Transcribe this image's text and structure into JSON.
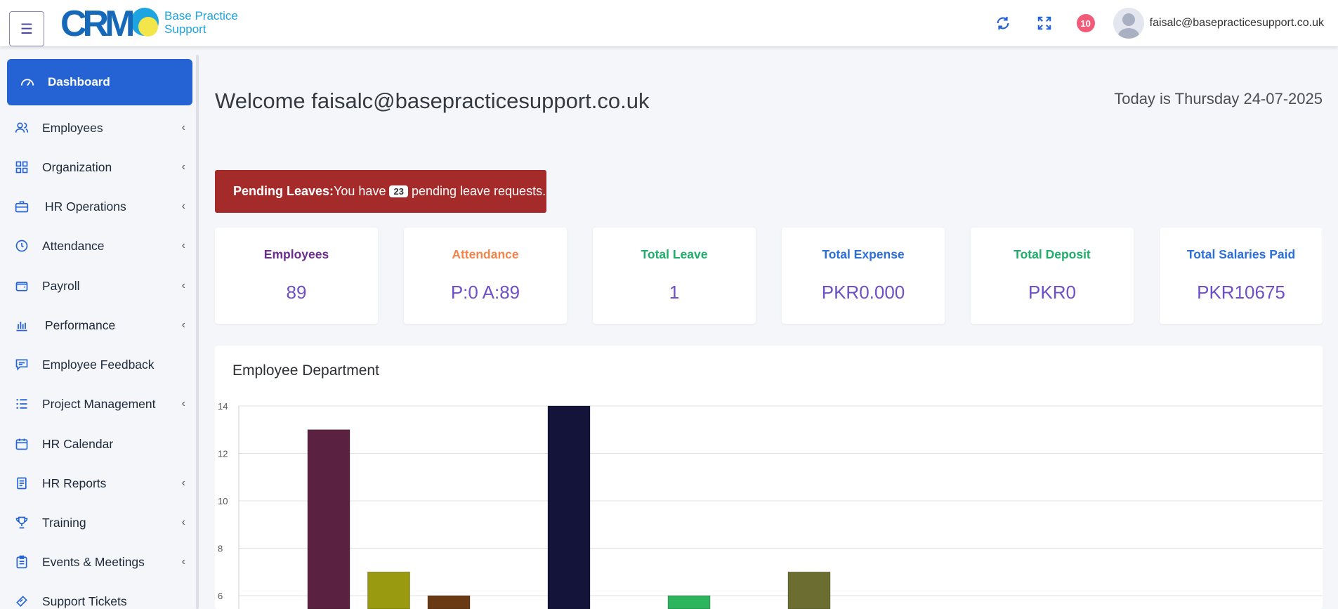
{
  "header": {
    "logo_letters": "CRM",
    "logo_text_line1": "Base Practice",
    "logo_text_line2": "Support",
    "notification_count": "10",
    "user_email": "faisalc@basepracticesupport.co.uk"
  },
  "sidebar": {
    "active": "Dashboard",
    "items": [
      {
        "label": "Employees",
        "icon": "users-icon",
        "chevron": true
      },
      {
        "label": "Organization",
        "icon": "grid-icon",
        "chevron": true
      },
      {
        "label": "HR Operations",
        "icon": "briefcase-icon",
        "chevron": true
      },
      {
        "label": "Attendance",
        "icon": "clock-icon",
        "chevron": true
      },
      {
        "label": "Payroll",
        "icon": "wallet-icon",
        "chevron": true
      },
      {
        "label": "Performance",
        "icon": "bar-chart-icon",
        "chevron": true
      },
      {
        "label": "Employee Feedback",
        "icon": "feedback-icon",
        "chevron": false
      },
      {
        "label": "Project Management",
        "icon": "list-icon",
        "chevron": true
      },
      {
        "label": "HR Calendar",
        "icon": "calendar-icon",
        "chevron": false
      },
      {
        "label": "HR Reports",
        "icon": "report-icon",
        "chevron": true
      },
      {
        "label": "Training",
        "icon": "trophy-icon",
        "chevron": true
      },
      {
        "label": "Events & Meetings",
        "icon": "clipboard-icon",
        "chevron": true
      },
      {
        "label": "Support Tickets",
        "icon": "ticket-icon",
        "chevron": false
      }
    ]
  },
  "main": {
    "welcome": "Welcome faisalc@basepracticesupport.co.uk",
    "today": "Today is Thursday 24-07-2025",
    "alert": {
      "title": "Pending Leaves:",
      "prefix": "You have",
      "count": "23",
      "suffix": "pending leave requests."
    },
    "cards": [
      {
        "label": "Employees",
        "value": "89",
        "color": "#6d2c8f"
      },
      {
        "label": "Attendance",
        "value": "P:0 A:89",
        "color": "#f2854a"
      },
      {
        "label": "Total Leave",
        "value": "1",
        "color": "#1fae6a"
      },
      {
        "label": "Total Expense",
        "value": "PKR0.000",
        "color": "#2b6fd9"
      },
      {
        "label": "Total Deposit",
        "value": "PKR0",
        "color": "#1fae6a"
      },
      {
        "label": "Total Salaries Paid",
        "value": "PKR10675",
        "color": "#2b6fd9"
      }
    ]
  },
  "chart_data": {
    "type": "bar",
    "title": "Employee Department",
    "yticks": [
      6,
      8,
      10,
      12,
      14
    ],
    "ylim": [
      5.4,
      14
    ],
    "grid": true,
    "values": [
      13,
      7,
      6,
      0,
      14,
      0,
      6,
      0,
      7
    ],
    "colors": [
      "#5a2240",
      "#9a9a10",
      "#6a3a14",
      "#ffffff",
      "#14143a",
      "#ffffff",
      "#2db55d",
      "#ffffff",
      "#6b6e30"
    ]
  }
}
